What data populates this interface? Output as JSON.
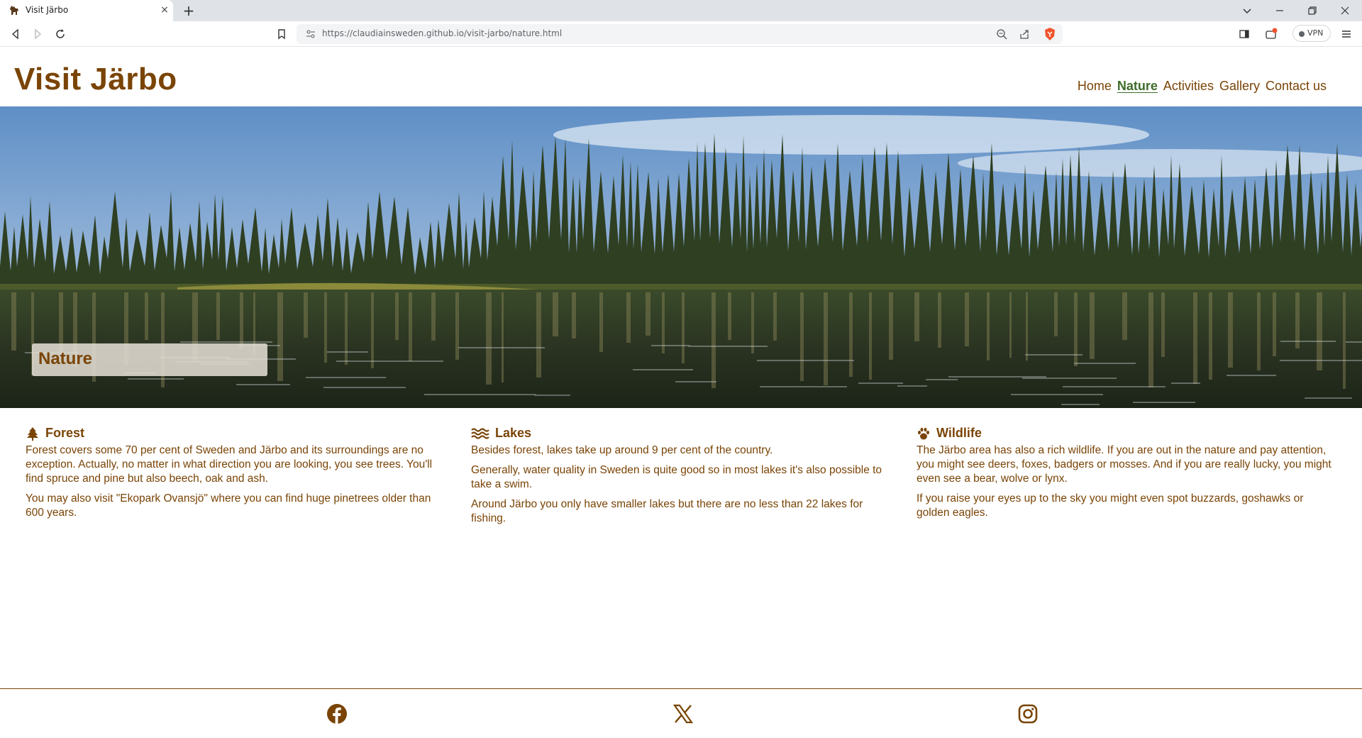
{
  "browser": {
    "tab_title": "Visit Järbo",
    "tab_close": "×",
    "new_tab": "+",
    "url": "https://claudiainsweden.github.io/visit-jarbo/nature.html",
    "vpn_label": "VPN"
  },
  "site": {
    "logo": "Visit Järbo",
    "nav": [
      {
        "label": "Home"
      },
      {
        "label": "Nature"
      },
      {
        "label": "Activities"
      },
      {
        "label": "Gallery"
      },
      {
        "label": "Contact us"
      }
    ],
    "hero_caption": "Nature"
  },
  "sections": [
    {
      "icon": "tree-icon",
      "title": "Forest",
      "paragraphs": [
        "Forest covers some 70 per cent of Sweden and Järbo and its surroundings are no exception. Actually, no matter in what direction you are looking, you see trees. You'll find spruce and pine but also beech, oak and ash.",
        "You may also visit \"Ekopark Ovansjö\" where you can find huge pinetrees older than 600 years."
      ]
    },
    {
      "icon": "water-icon",
      "title": "Lakes",
      "paragraphs": [
        "Besides forest, lakes take up around 9 per cent of the country.",
        "Generally, water quality in Sweden is quite good so in most lakes it's also possible to take a swim.",
        "Around Järbo you only have smaller lakes but there are no less than 22 lakes for fishing."
      ]
    },
    {
      "icon": "paw-icon",
      "title": "Wildlife",
      "paragraphs": [
        "The Järbo area has also a rich wildlife. If you are out in the nature and pay attention, you might see deers, foxes, badgers or mosses. And if you are really lucky, you might even see a bear, wolve or lynx.",
        "If you raise your eyes up to the sky you might even spot buzzards, goshawks or golden eagles."
      ]
    }
  ],
  "footer": {
    "social": [
      "facebook-icon",
      "x-icon",
      "instagram-icon"
    ]
  },
  "colors": {
    "brand_brown": "#7a4406",
    "active_green": "#3e6b2a"
  }
}
